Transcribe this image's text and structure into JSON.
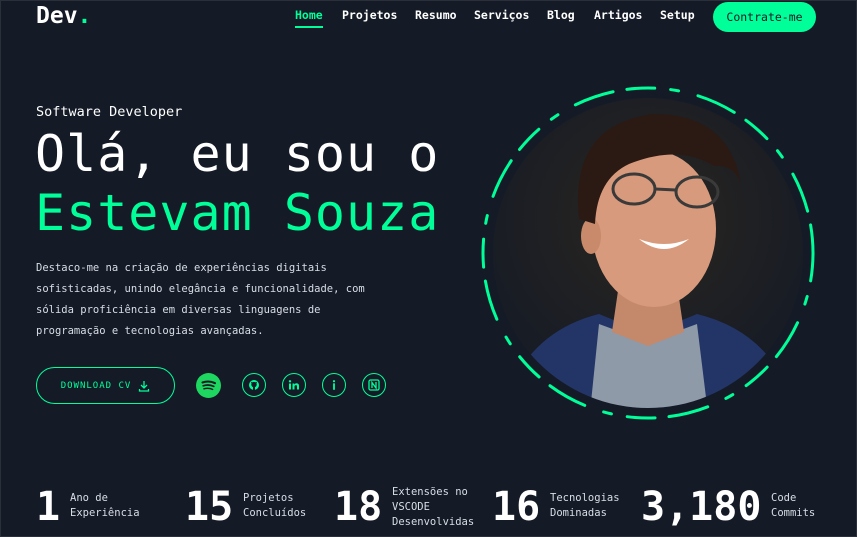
{
  "header": {
    "logo_text": "Dev",
    "logo_dot": ".",
    "nav": [
      {
        "label": "Home",
        "active": true
      },
      {
        "label": "Projetos",
        "active": false
      },
      {
        "label": "Resumo",
        "active": false
      },
      {
        "label": "Serviços",
        "active": false
      },
      {
        "label": "Blog",
        "active": false
      },
      {
        "label": "Artigos",
        "active": false
      },
      {
        "label": "Setup",
        "active": false
      }
    ],
    "hire_button": "Contrate-me"
  },
  "hero": {
    "role": "Software Developer",
    "greeting": "Olá, eu sou o",
    "name": "Estevam Souza",
    "description_lines": [
      "Destaco-me na criação de experiências digitais",
      "sofisticadas, unindo elegância e funcionalidade, com",
      "sólida proficiência em diversas linguagens de",
      "programação e tecnologias avançadas."
    ],
    "cv_button": "DOWNLOAD CV",
    "socials": [
      "spotify-icon",
      "github-icon",
      "linkedin-icon",
      "info-icon",
      "notion-icon"
    ]
  },
  "stats": [
    {
      "number": "1",
      "label_lines": [
        "Ano de",
        "Experiência"
      ]
    },
    {
      "number": "15",
      "label_lines": [
        "Projetos",
        "Concluídos"
      ]
    },
    {
      "number": "18",
      "label_lines": [
        "Extensões no",
        "VSCODE",
        "Desenvolvidas"
      ]
    },
    {
      "number": "16",
      "label_lines": [
        "Tecnologias",
        "Dominadas"
      ]
    },
    {
      "number": "3,180",
      "label_lines": [
        "Code",
        "Commits"
      ]
    }
  ],
  "colors": {
    "accent": "#00ff99",
    "background": "#141a26",
    "spotify": "#1ed760"
  }
}
